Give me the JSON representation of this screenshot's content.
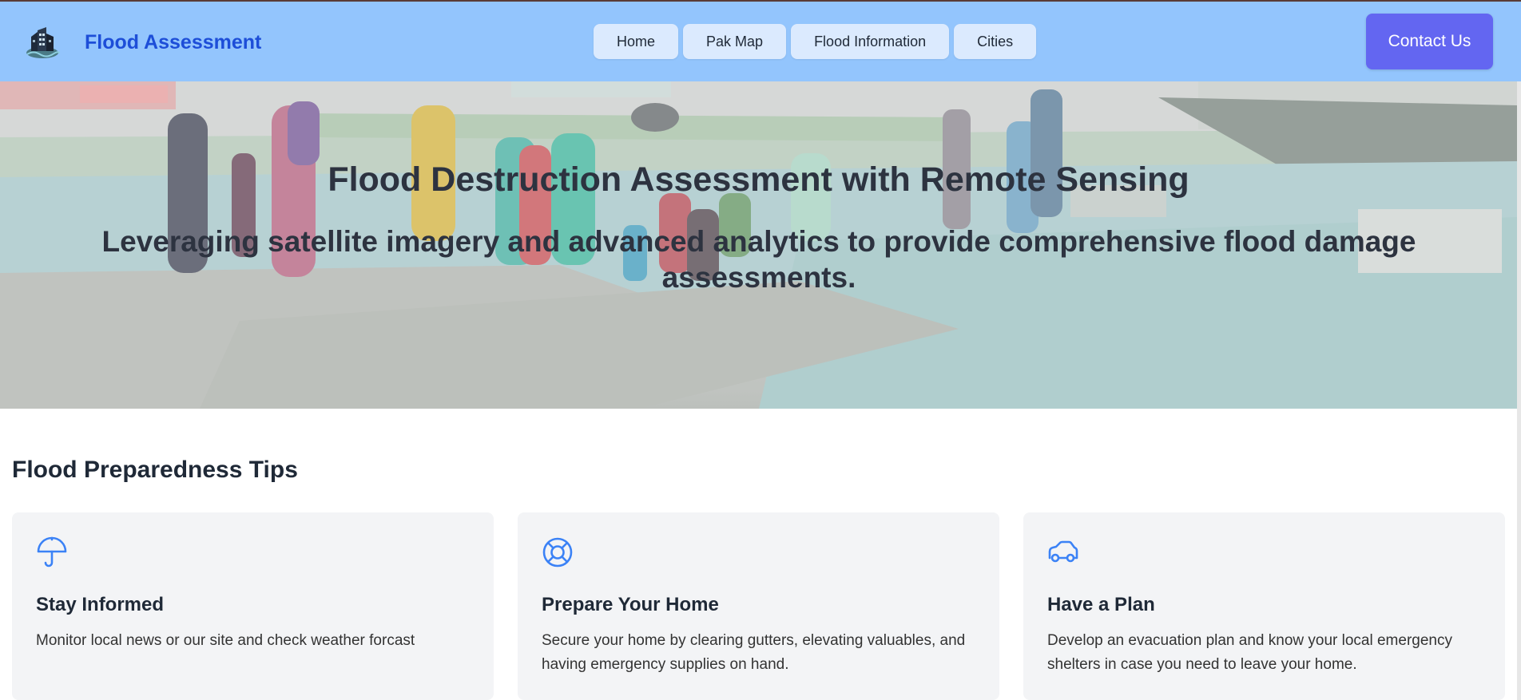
{
  "header": {
    "brand_name": "Flood Assessment",
    "logo_icon": "building-logo-icon",
    "nav": [
      {
        "label": "Home"
      },
      {
        "label": "Pak Map"
      },
      {
        "label": "Flood Information"
      },
      {
        "label": "Cities"
      }
    ],
    "contact_label": "Contact Us"
  },
  "hero": {
    "title": "Flood Destruction Assessment with Remote Sensing",
    "subtitle": "Leveraging satellite imagery and advanced analytics to provide comprehensive flood damage assessments."
  },
  "tips": {
    "heading": "Flood Preparedness Tips",
    "cards": [
      {
        "icon": "umbrella-icon",
        "title": "Stay Informed",
        "text": "Monitor local news or our site and check weather forcast"
      },
      {
        "icon": "lifebuoy-icon",
        "title": "Prepare Your Home",
        "text": "Secure your home by clearing gutters, elevating valuables, and having emergency supplies on hand."
      },
      {
        "icon": "car-icon",
        "title": "Have a Plan",
        "text": "Develop an evacuation plan and know your local emergency shelters in case you need to leave your home."
      }
    ]
  },
  "colors": {
    "header_bg": "#93c5fd",
    "brand": "#1d4ed8",
    "nav_button_bg": "#dbeafe",
    "contact_bg": "#6366f1",
    "card_bg": "#f3f4f6",
    "icon_color": "#3b82f6"
  }
}
